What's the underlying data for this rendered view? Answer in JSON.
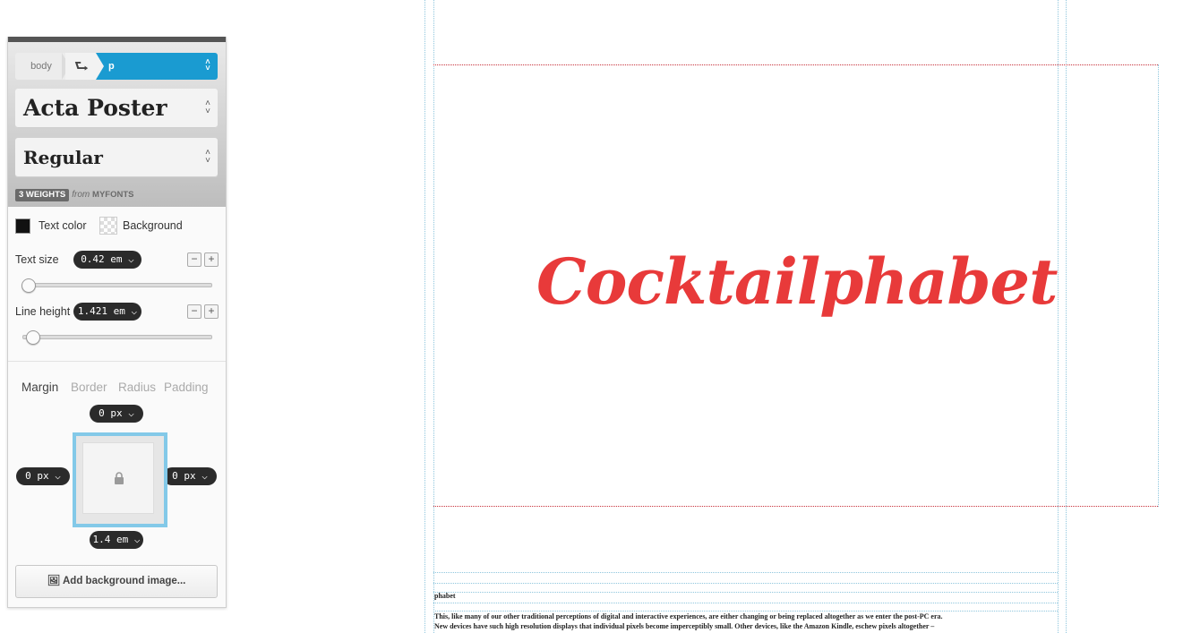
{
  "breadcrumb": {
    "parent": "body",
    "current": "p"
  },
  "font": {
    "family": "Acta Poster",
    "style": "Regular",
    "weights_badge": "3 WEIGHTS",
    "from": "from",
    "source": "MYFONTS"
  },
  "colors_row": {
    "text_color_label": "Text color",
    "background_label": "Background"
  },
  "text_size": {
    "label": "Text size",
    "value": "0.42 em",
    "slider_fraction": 0.02
  },
  "line_height": {
    "label": "Line height",
    "value": "1.421 em",
    "slider_fraction": 0.05
  },
  "box_tabs": [
    "Margin",
    "Border",
    "Radius",
    "Padding"
  ],
  "margin": {
    "top": "0 px",
    "left": "0 px",
    "right": "0 px",
    "bottom": "1.4 em"
  },
  "add_background_label": "Add background image...",
  "canvas": {
    "headline": "Cocktailphabet",
    "subheading": "phabet",
    "paragraph_line1": "This, like many of our other traditional perceptions of digital and interactive experiences, are either changing or being replaced altogether as we enter the post-PC era.",
    "paragraph_line2": "New devices have such high resolution displays that individual pixels become imperceptibly small. Other devices, like the Amazon Kindle, eschew pixels altogether –",
    "headline_color": "#e83a3a"
  },
  "accent": "#1a9bd1"
}
